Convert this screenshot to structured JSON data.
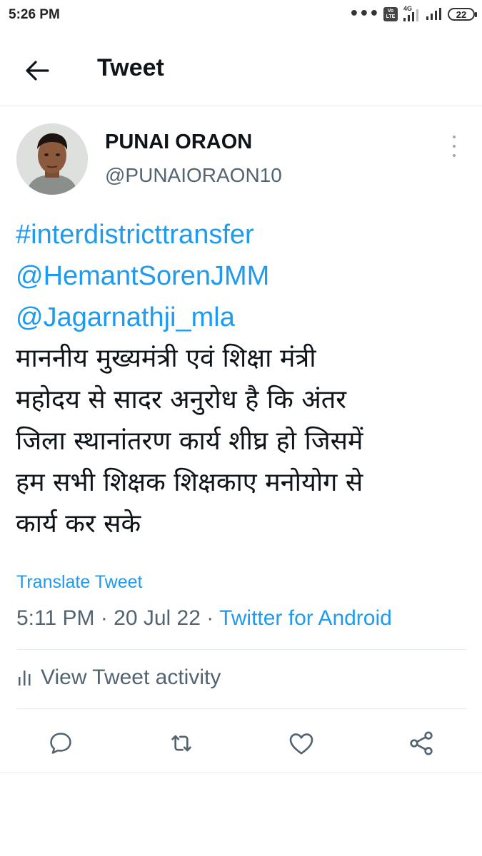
{
  "status_bar": {
    "time": "5:26 PM",
    "volte_top": "Vo",
    "volte_bottom": "LTE",
    "network": "4G",
    "battery": "22"
  },
  "header": {
    "title": "Tweet"
  },
  "tweet": {
    "display_name": "PUNAI ORAON",
    "handle": "@PUNAIORAON10",
    "lines": [
      "#interdistricttransfer",
      "@HemantSorenJMM",
      "@Jagarnathji_mla"
    ],
    "hindi_lines": [
      "माननीय मुख्यमंत्री एवं शिक्षा मंत्री",
      "महोदय से सादर अनुरोध है कि अंतर",
      "जिला स्थानांतरण कार्य शीघ्र हो जिसमें",
      "हम सभी शिक्षक शिक्षकाए मनोयोग से",
      "कार्य कर सके"
    ],
    "translate_label": "Translate Tweet",
    "time": "5:11 PM",
    "separator": " · ",
    "date": "20 Jul 22",
    "source": "Twitter for Android",
    "activity_label": "View Tweet activity"
  },
  "icons": {
    "back": "arrow-left-icon",
    "more": "more-vertical-icon",
    "reply": "reply-icon",
    "retweet": "retweet-icon",
    "like": "heart-icon",
    "share": "share-icon",
    "activity": "bar-chart-icon"
  },
  "colors": {
    "link": "#1d9bf0",
    "secondary": "#536471",
    "primary": "#0f1419"
  }
}
